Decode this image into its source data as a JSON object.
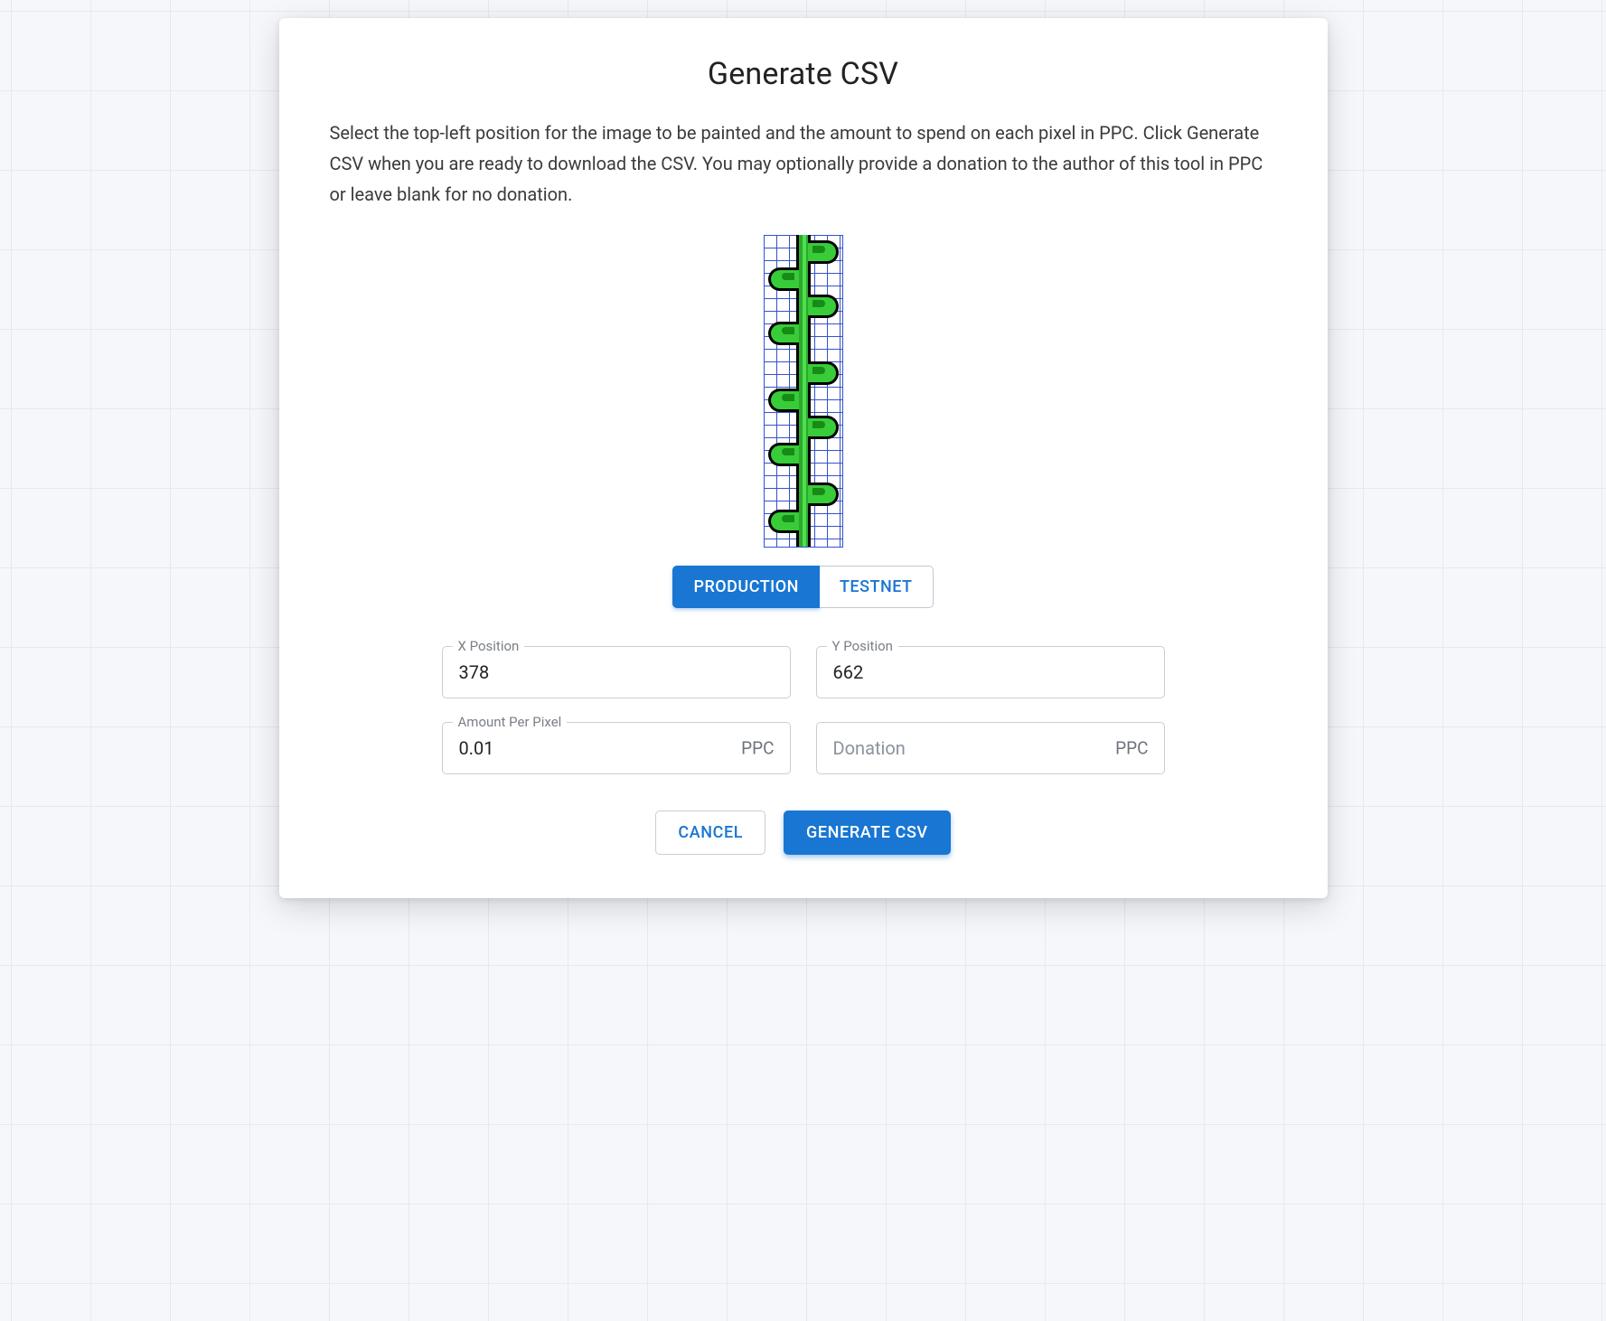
{
  "dialog": {
    "title": "Generate CSV",
    "description": "Select the top-left position for the image to be painted and the amount to spend on each pixel in PPC. Click Generate CSV when you are ready to download the CSV. You may optionally provide a donation to the author of this tool in PPC or leave blank for no donation."
  },
  "toggle": {
    "production_label": "PRODUCTION",
    "testnet_label": "TESTNET",
    "active": "production"
  },
  "fields": {
    "x_position": {
      "label": "X Position",
      "value": "378"
    },
    "y_position": {
      "label": "Y Position",
      "value": "662"
    },
    "amount_per_pixel": {
      "label": "Amount Per Pixel",
      "value": "0.01",
      "suffix": "PPC"
    },
    "donation": {
      "placeholder": "Donation",
      "value": "",
      "suffix": "PPC"
    }
  },
  "actions": {
    "cancel_label": "CANCEL",
    "generate_label": "GENERATE CSV"
  }
}
